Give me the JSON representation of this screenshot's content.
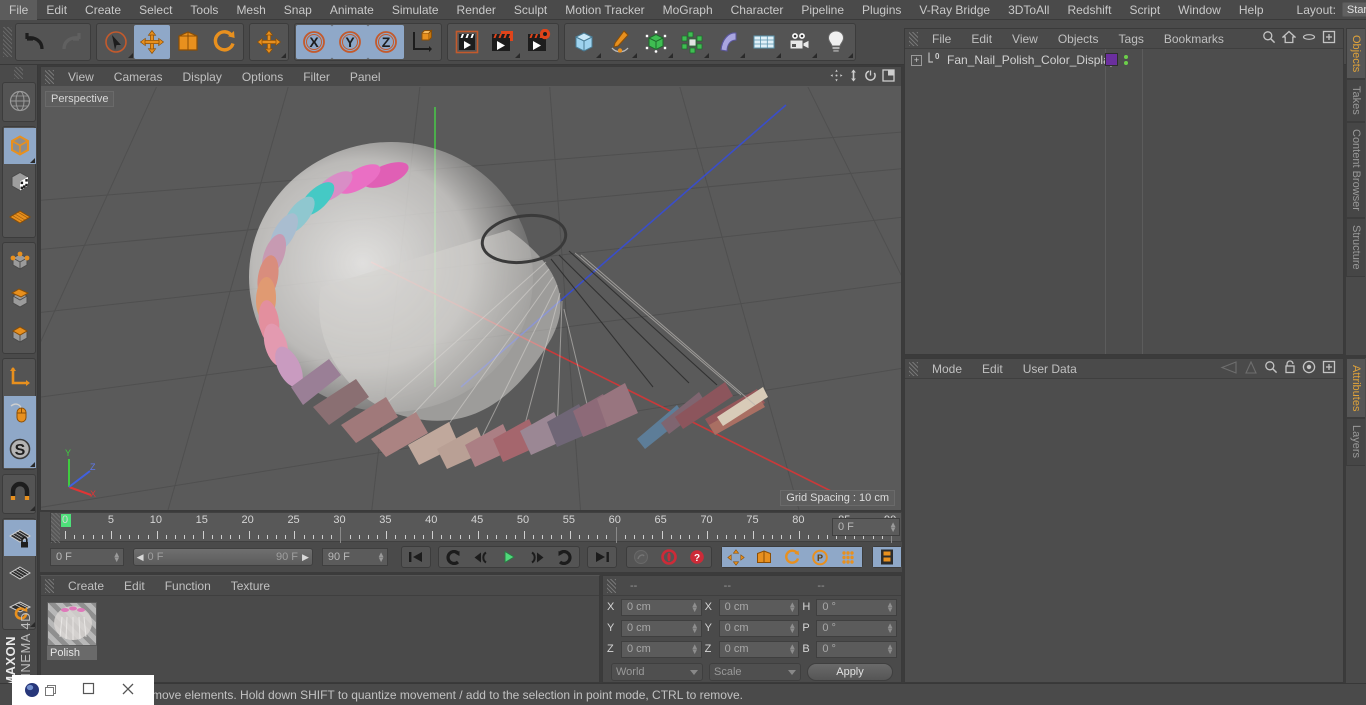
{
  "app": {
    "brand_top": "MAXON",
    "brand_bottom": "CINEMA 4D"
  },
  "menubar": {
    "items": [
      "File",
      "Edit",
      "Create",
      "Select",
      "Tools",
      "Mesh",
      "Snap",
      "Animate",
      "Simulate",
      "Render",
      "Sculpt",
      "Motion Tracker",
      "MoGraph",
      "Character",
      "Pipeline",
      "Plugins",
      "V-Ray Bridge",
      "3DToAll",
      "Redshift",
      "Script",
      "Window",
      "Help"
    ],
    "layout_label": "Layout:",
    "layout_value": "Startup",
    "search_icon": "search-icon"
  },
  "toolbar": {
    "groups": [
      {
        "name": "history",
        "buttons": [
          {
            "name": "undo-button",
            "icon": "undo-arrow-icon",
            "selected": false,
            "dim": false,
            "corner": false
          },
          {
            "name": "redo-button",
            "icon": "redo-arrow-icon",
            "selected": false,
            "dim": true,
            "corner": false
          }
        ]
      },
      {
        "name": "transform",
        "buttons": [
          {
            "name": "live-selection-tool",
            "icon": "cursor-circle-icon",
            "selected": false,
            "dim": false,
            "corner": true
          },
          {
            "name": "move-tool",
            "icon": "move-arrows-icon",
            "selected": true,
            "dim": false,
            "corner": false
          },
          {
            "name": "scale-tool",
            "icon": "scale-box-icon",
            "selected": false,
            "dim": false,
            "corner": false
          },
          {
            "name": "rotate-tool",
            "icon": "rotate-arc-icon",
            "selected": false,
            "dim": false,
            "corner": false
          }
        ]
      },
      {
        "name": "move-dup",
        "buttons": [
          {
            "name": "move-duplicate-tool",
            "icon": "move-arrows-icon",
            "selected": false,
            "dim": false,
            "corner": true
          }
        ]
      },
      {
        "name": "axis-locks",
        "buttons": [
          {
            "name": "lock-x-axis",
            "icon": "x-axis-icon",
            "selected": true,
            "dim": false,
            "corner": false
          },
          {
            "name": "lock-y-axis",
            "icon": "y-axis-icon",
            "selected": true,
            "dim": false,
            "corner": false
          },
          {
            "name": "lock-z-axis",
            "icon": "z-axis-icon",
            "selected": true,
            "dim": false,
            "corner": false
          },
          {
            "name": "world-object-axis",
            "icon": "axis-cube-icon",
            "selected": false,
            "dim": false,
            "corner": false
          }
        ]
      },
      {
        "name": "render",
        "buttons": [
          {
            "name": "render-view-button",
            "icon": "clapper-render-icon",
            "selected": false,
            "dim": false,
            "corner": false
          },
          {
            "name": "render-to-picture-viewer",
            "icon": "clapper-picture-icon",
            "selected": false,
            "dim": false,
            "corner": true
          },
          {
            "name": "render-settings-button",
            "icon": "clapper-gear-icon",
            "selected": false,
            "dim": false,
            "corner": false
          }
        ]
      },
      {
        "name": "create",
        "buttons": [
          {
            "name": "add-cube-object",
            "icon": "cube-blue-icon",
            "selected": false,
            "dim": false,
            "corner": true
          },
          {
            "name": "add-spline-object",
            "icon": "pen-spline-icon",
            "selected": false,
            "dim": false,
            "corner": true
          },
          {
            "name": "add-generator-object",
            "icon": "green-cube-icon",
            "selected": false,
            "dim": false,
            "corner": true
          },
          {
            "name": "add-array-object",
            "icon": "green-cluster-icon",
            "selected": false,
            "dim": false,
            "corner": true
          },
          {
            "name": "add-bend-deformer",
            "icon": "bend-deformer-icon",
            "selected": false,
            "dim": false,
            "corner": true
          },
          {
            "name": "add-floor-environment",
            "icon": "floor-grid-icon",
            "selected": false,
            "dim": false,
            "corner": true
          },
          {
            "name": "add-camera",
            "icon": "camera-icon",
            "selected": false,
            "dim": false,
            "corner": true
          },
          {
            "name": "add-light",
            "icon": "light-bulb-icon",
            "selected": false,
            "dim": false,
            "corner": true
          }
        ]
      }
    ]
  },
  "left_toolbar": {
    "groups": [
      {
        "name": "mode-globe",
        "buttons": [
          {
            "name": "texture-axis-mode",
            "icon": "globe-grid-icon",
            "selected": false,
            "corner": false
          }
        ]
      },
      {
        "name": "editable",
        "buttons": [
          {
            "name": "make-editable-button",
            "icon": "editable-cube-icon",
            "selected": true,
            "corner": true
          },
          {
            "name": "model-mode",
            "icon": "model-checker-cube-icon",
            "selected": false,
            "corner": false
          },
          {
            "name": "texture-mode",
            "icon": "texture-grid-icon",
            "selected": false,
            "corner": false
          }
        ]
      },
      {
        "name": "components",
        "buttons": [
          {
            "name": "points-mode",
            "icon": "points-cube-icon",
            "selected": false,
            "corner": false
          },
          {
            "name": "edges-mode",
            "icon": "edges-cube-icon",
            "selected": false,
            "corner": false
          },
          {
            "name": "polygons-mode",
            "icon": "polygons-cube-icon",
            "selected": false,
            "corner": false
          }
        ]
      },
      {
        "name": "axis-tools",
        "buttons": [
          {
            "name": "enable-axis-modification",
            "icon": "axis-l-icon",
            "selected": false,
            "corner": false
          },
          {
            "name": "viewport-solo-single",
            "icon": "mouse-icon",
            "selected": true,
            "corner": false
          },
          {
            "name": "soft-selection-toggle",
            "icon": "s-circle-icon",
            "selected": true,
            "corner": true
          }
        ]
      },
      {
        "name": "snap",
        "buttons": [
          {
            "name": "enable-snapping",
            "icon": "magnet-icon",
            "selected": false,
            "corner": true
          }
        ]
      },
      {
        "name": "workplane",
        "buttons": [
          {
            "name": "lock-workplane",
            "icon": "grid-lock-icon",
            "selected": true,
            "corner": false
          },
          {
            "name": "planar-workplane",
            "icon": "grid-plane-icon",
            "selected": false,
            "corner": false
          },
          {
            "name": "workplane-rotate",
            "icon": "grid-rotate-icon",
            "selected": false,
            "corner": true
          }
        ]
      }
    ]
  },
  "viewport": {
    "menu_items": [
      "View",
      "Cameras",
      "Display",
      "Options",
      "Filter",
      "Panel"
    ],
    "corner_icons": [
      "pan-move-icon",
      "vertical-move-icon",
      "rotate-view-icon",
      "maximize-view-icon"
    ],
    "perspective_label": "Perspective",
    "grid_label": "Grid Spacing : 10 cm",
    "axis_gizmo": {
      "x_label": "X",
      "y_label": "Y",
      "z_label": "Z",
      "x_color": "#e03535",
      "y_color": "#3fcc3f",
      "z_color": "#4060e0"
    },
    "scene_object": "fan-nail-polish-color-display",
    "background_color": "#5a5a5a",
    "grid_color": "#4f4f4f"
  },
  "timeline": {
    "ticks": [
      0,
      5,
      10,
      15,
      20,
      25,
      30,
      35,
      40,
      45,
      50,
      55,
      60,
      65,
      70,
      75,
      80,
      85,
      90
    ],
    "current_frame": "0 F",
    "range_start": "0 F",
    "range_end": "90 F",
    "max_frame": "90 F",
    "right_field": "0 F",
    "transport_buttons": [
      {
        "name": "go-to-start-button",
        "icon": "skip-start-icon",
        "selected": false,
        "dim": false
      },
      {
        "name": "go-to-previous-key",
        "icon": "loop-back-icon",
        "selected": false,
        "dim": false
      },
      {
        "name": "step-back-button",
        "icon": "step-back-icon",
        "selected": false,
        "dim": false
      },
      {
        "name": "play-button",
        "icon": "play-icon",
        "selected": false,
        "dim": false
      },
      {
        "name": "step-forward-button",
        "icon": "step-forward-icon",
        "selected": false,
        "dim": false
      },
      {
        "name": "go-to-next-key",
        "icon": "loop-forward-icon",
        "selected": false,
        "dim": false
      },
      {
        "name": "go-to-end-button",
        "icon": "skip-end-icon",
        "selected": false,
        "dim": false
      }
    ],
    "record_buttons": [
      {
        "name": "autokeying-toggle",
        "icon": "key-icon",
        "selected": false,
        "dim": true
      },
      {
        "name": "record-active-objects",
        "icon": "record-circle-icon",
        "selected": false,
        "dim": false
      },
      {
        "name": "auto-keying-button",
        "icon": "question-circle-icon",
        "selected": false,
        "dim": false
      }
    ],
    "key_param_buttons": [
      {
        "name": "key-position-toggle",
        "icon": "move-arrows-icon",
        "selected": true
      },
      {
        "name": "key-scale-toggle",
        "icon": "scale-box-icon",
        "selected": true
      },
      {
        "name": "key-rotation-toggle",
        "icon": "rotate-arc-icon",
        "selected": true
      },
      {
        "name": "key-parameter-toggle",
        "icon": "p-circle-icon",
        "selected": true
      },
      {
        "name": "key-pla-toggle",
        "icon": "dots-grid-icon",
        "selected": true
      }
    ],
    "filmstrip_button": {
      "name": "keyframe-selection-button",
      "icon": "filmstrip-icon",
      "selected": true
    }
  },
  "material_manager": {
    "menu_items": [
      "Create",
      "Edit",
      "Function",
      "Texture"
    ],
    "materials": [
      {
        "name": "Polish"
      }
    ]
  },
  "coordinates": {
    "headers": [
      "--",
      "--",
      "--"
    ],
    "rows": [
      {
        "pos_label": "X",
        "pos_value": "0 cm",
        "size_label": "X",
        "size_value": "0 cm",
        "rot_label": "H",
        "rot_value": "0 °"
      },
      {
        "pos_label": "Y",
        "pos_value": "0 cm",
        "size_label": "Y",
        "size_value": "0 cm",
        "rot_label": "P",
        "rot_value": "0 °"
      },
      {
        "pos_label": "Z",
        "pos_value": "0 cm",
        "size_label": "Z",
        "size_value": "0 cm",
        "rot_label": "B",
        "rot_value": "0 °"
      }
    ],
    "system_dropdown": "World",
    "mode_dropdown": "Scale",
    "apply_label": "Apply"
  },
  "object_manager": {
    "menu_items": [
      "File",
      "Edit",
      "View",
      "Objects",
      "Tags",
      "Bookmarks"
    ],
    "header_icons": [
      "search-icon",
      "home-icon",
      "ellipse-icon",
      "new-window-icon"
    ],
    "objects": [
      {
        "name": "Fan_Nail_Polish_Color_Display",
        "level_badge": "0",
        "tag_color": "#6b2f9e",
        "visible": true
      }
    ]
  },
  "attribute_manager": {
    "menu_items": [
      "Mode",
      "Edit",
      "User Data"
    ],
    "header_icons": [
      "back-arrow-icon",
      "forward-arrow-icon",
      "search-icon",
      "lock-icon",
      "target-icon",
      "new-window-icon"
    ],
    "content": ""
  },
  "right_tabs": {
    "top": [
      {
        "label": "Objects",
        "active": true
      },
      {
        "label": "Takes",
        "active": false
      },
      {
        "label": "Content Browser",
        "active": false
      },
      {
        "label": "Structure",
        "active": false
      }
    ],
    "bottom": [
      {
        "label": "Attributes",
        "active": true
      },
      {
        "label": "Layers",
        "active": false
      }
    ]
  },
  "statusbar": {
    "text": "move elements. Hold down SHIFT to quantize movement / add to the selection in point mode, CTRL to remove."
  },
  "window_controls": {
    "app_icon": "c4d-app-icon",
    "restore": "restore-icon",
    "maximize": "maximize-icon",
    "close": "close-icon"
  }
}
